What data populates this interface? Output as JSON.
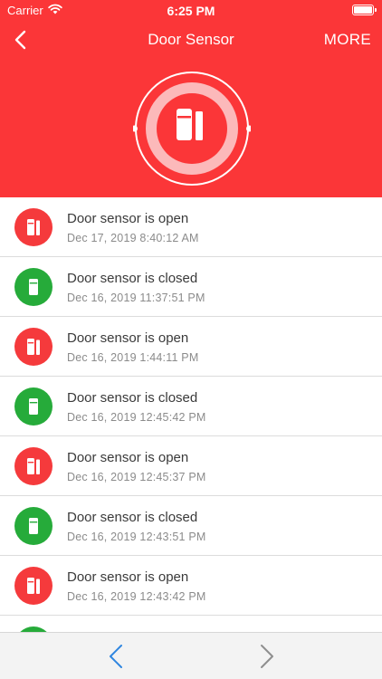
{
  "status_bar": {
    "carrier": "Carrier",
    "time": "6:25 PM",
    "wifi_icon": "wifi-icon",
    "battery_icon": "battery-full-icon"
  },
  "nav": {
    "title": "Door Sensor",
    "more_label": "MORE",
    "back_icon": "chevron-left-icon"
  },
  "colors": {
    "header": "#fb3638",
    "open": "#f53a3c",
    "closed": "#26ab3a",
    "toolbar_accent": "#2f86e0",
    "toolbar_muted": "#8e8e8e"
  },
  "events": [
    {
      "title": "Door sensor is open",
      "time": "Dec 17, 2019 8:40:12 AM",
      "state": "open"
    },
    {
      "title": "Door sensor is closed",
      "time": "Dec 16, 2019 11:37:51 PM",
      "state": "closed"
    },
    {
      "title": "Door sensor is open",
      "time": "Dec 16, 2019 1:44:11 PM",
      "state": "open"
    },
    {
      "title": "Door sensor is closed",
      "time": "Dec 16, 2019 12:45:42 PM",
      "state": "closed"
    },
    {
      "title": "Door sensor is open",
      "time": "Dec 16, 2019 12:45:37 PM",
      "state": "open"
    },
    {
      "title": "Door sensor is closed",
      "time": "Dec 16, 2019 12:43:51 PM",
      "state": "closed"
    },
    {
      "title": "Door sensor is open",
      "time": "Dec 16, 2019 12:43:42 PM",
      "state": "open"
    },
    {
      "title": "",
      "time": "",
      "state": "closed"
    }
  ],
  "toolbar": {
    "prev_icon": "chevron-left-icon",
    "next_icon": "chevron-right-icon"
  }
}
